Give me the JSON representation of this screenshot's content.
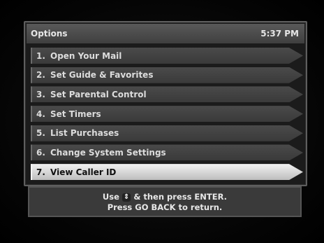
{
  "header": {
    "title": "Options",
    "time": "5:37 PM"
  },
  "menu": {
    "items": [
      {
        "num": "1.",
        "label": "Open Your Mail",
        "selected": false
      },
      {
        "num": "2.",
        "label": "Set Guide & Favorites",
        "selected": false
      },
      {
        "num": "3.",
        "label": "Set Parental Control",
        "selected": false
      },
      {
        "num": "4.",
        "label": "Set Timers",
        "selected": false
      },
      {
        "num": "5.",
        "label": "List Purchases",
        "selected": false
      },
      {
        "num": "6.",
        "label": "Change System Settings",
        "selected": false
      },
      {
        "num": "7.",
        "label": "View Caller ID",
        "selected": true
      }
    ]
  },
  "footer": {
    "line1_prefix": "Use",
    "arrow_icon": "up-down-arrow-icon",
    "line1_suffix": "& then press ENTER.",
    "line2": "Press GO BACK to return."
  }
}
